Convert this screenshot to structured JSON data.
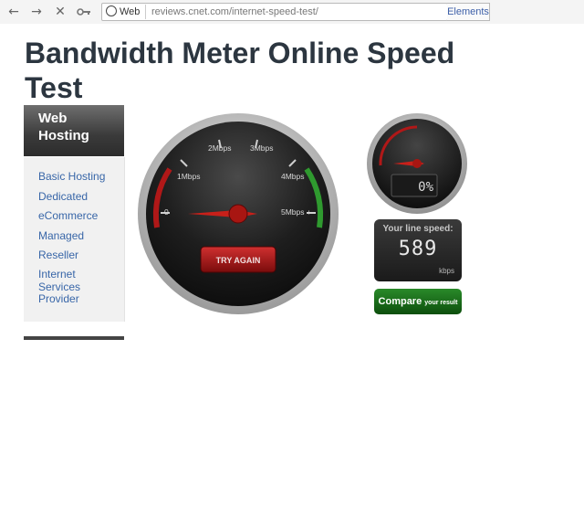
{
  "browser": {
    "chip_label": "Web",
    "url": "reviews.cnet.com/internet-speed-test/",
    "elements_label": "Elements",
    "icons": [
      "back-arrow-icon",
      "forward-arrow-icon",
      "stop-icon",
      "key-icon",
      "globe-icon"
    ]
  },
  "page": {
    "title": "Bandwidth Meter Online Speed Test"
  },
  "sidebar": {
    "heading": "Web Hosting",
    "items": [
      {
        "label": "Basic Hosting"
      },
      {
        "label": "Dedicated"
      },
      {
        "label": "eCommerce"
      },
      {
        "label": "Managed"
      },
      {
        "label": "Reseller"
      },
      {
        "label": "Internet Services Provider"
      }
    ]
  },
  "main_gauge": {
    "scale_labels": [
      "0",
      "1Mbps",
      "2Mbps",
      "3Mbps",
      "4Mbps",
      "5Mbps +"
    ],
    "try_again_label": "TRY AGAIN"
  },
  "small_gauge": {
    "readout": "0%"
  },
  "speed_panel": {
    "label": "Your line speed:",
    "value": "589",
    "unit": "kbps"
  },
  "compare": {
    "main": "Compare",
    "sub": "your result"
  },
  "colors": {
    "title": "#2c3640",
    "link": "#3866a8",
    "needle": "#c8201a",
    "gauge_red": "#b01818",
    "gauge_green": "#2f9a2f",
    "compare_green": "#1a6e1a"
  }
}
